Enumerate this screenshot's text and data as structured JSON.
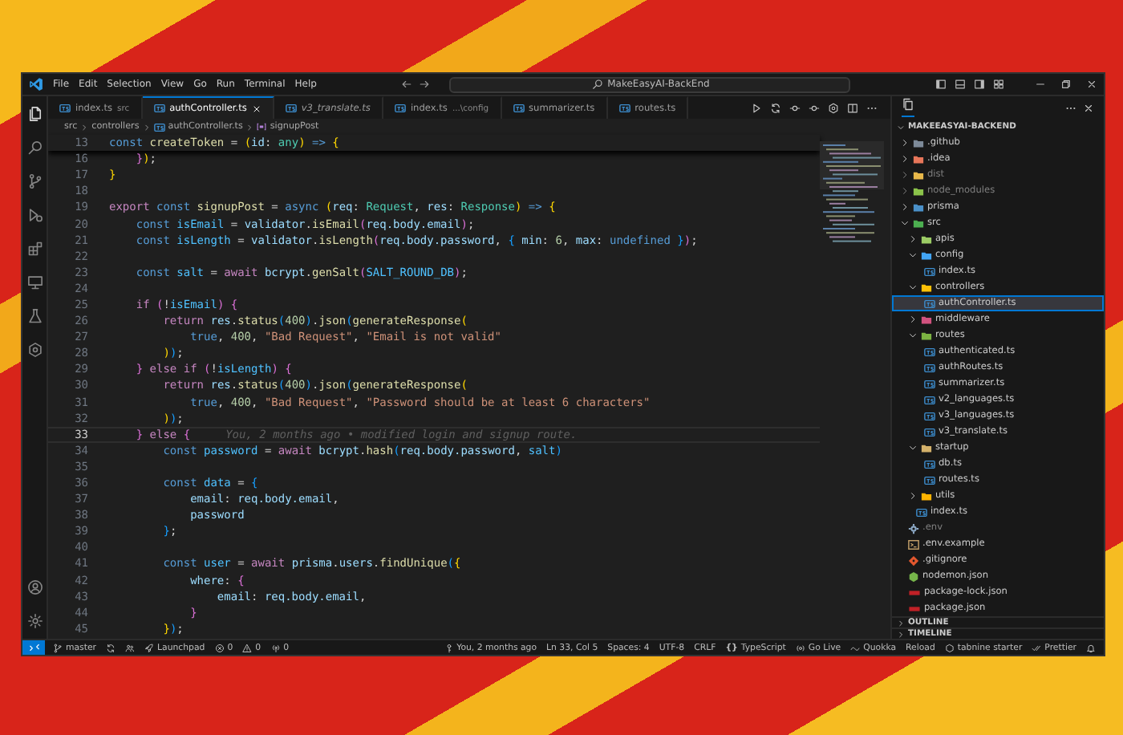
{
  "title_bar": {
    "menu": [
      "File",
      "Edit",
      "Selection",
      "View",
      "Go",
      "Run",
      "Terminal",
      "Help"
    ],
    "search": "MakeEasyAI-BackEnd"
  },
  "editor": {
    "tabs": [
      {
        "label": "index.ts",
        "description": "src",
        "selected": false,
        "preview": false
      },
      {
        "label": "authController.ts",
        "selected": true,
        "preview": false
      },
      {
        "label": "v3_translate.ts",
        "selected": false,
        "preview": true
      },
      {
        "label": "index.ts",
        "description": "...\\config",
        "selected": false,
        "preview": false
      },
      {
        "label": "summarizer.ts",
        "selected": false,
        "preview": false
      },
      {
        "label": "routes.ts",
        "selected": false,
        "preview": false
      }
    ],
    "breadcrumbs": [
      {
        "text": "src",
        "kind": "folder"
      },
      {
        "text": "controllers",
        "kind": "folder"
      },
      {
        "text": "authController.ts",
        "kind": "file"
      },
      {
        "text": "signupPost",
        "kind": "symbol"
      }
    ],
    "sticky_line": {
      "number": "13",
      "tokens": [
        {
          "text": "const",
          "kind": "kw"
        },
        {
          "text": " createToken",
          "kind": "fn"
        },
        {
          "text": " = "
        },
        {
          "text": "(",
          "kind": "b1"
        },
        {
          "text": "id",
          "kind": "var"
        },
        {
          "text": ": "
        },
        {
          "text": "any",
          "kind": "type"
        },
        {
          "text": ")",
          "kind": "b1"
        },
        {
          "text": " => ",
          "kind": "kw"
        },
        {
          "text": "{",
          "kind": "b1"
        }
      ]
    },
    "lines": [
      {
        "number": "16",
        "current": false,
        "tokens": [
          {
            "text": "    }",
            "kind": "b2"
          },
          {
            "text": ")",
            "kind": "b1"
          },
          {
            "text": ";"
          }
        ]
      },
      {
        "number": "17",
        "current": false,
        "tokens": [
          {
            "text": "}",
            "kind": "b1"
          }
        ]
      },
      {
        "number": "18",
        "current": false
      },
      {
        "number": "19",
        "current": false,
        "tokens": [
          {
            "text": "export",
            "kind": "ctl"
          },
          {
            "text": " const",
            "kind": "kw"
          },
          {
            "text": " signupPost",
            "kind": "fn"
          },
          {
            "text": " = "
          },
          {
            "text": "async",
            "kind": "kw"
          },
          {
            "text": " (",
            "kind": "b1"
          },
          {
            "text": "req",
            "kind": "var"
          },
          {
            "text": ": "
          },
          {
            "text": "Request",
            "kind": "type"
          },
          {
            "text": ", "
          },
          {
            "text": "res",
            "kind": "var"
          },
          {
            "text": ": "
          },
          {
            "text": "Response",
            "kind": "type"
          },
          {
            "text": ")",
            "kind": "b1"
          },
          {
            "text": " => ",
            "kind": "kw"
          },
          {
            "text": "{",
            "kind": "b1"
          }
        ]
      },
      {
        "number": "20",
        "current": false,
        "tokens": [
          {
            "text": "    const",
            "kind": "kw"
          },
          {
            "text": " isEmail",
            "kind": "cvar"
          },
          {
            "text": " = "
          },
          {
            "text": "validator",
            "kind": "var"
          },
          {
            "text": "."
          },
          {
            "text": "isEmail",
            "kind": "fn"
          },
          {
            "text": "(",
            "kind": "b2"
          },
          {
            "text": "req.body.email",
            "kind": "var"
          },
          {
            "text": ")",
            "kind": "b2"
          },
          {
            "text": ";"
          }
        ]
      },
      {
        "number": "21",
        "current": false,
        "tokens": [
          {
            "text": "    const",
            "kind": "kw"
          },
          {
            "text": " isLength",
            "kind": "cvar"
          },
          {
            "text": " = "
          },
          {
            "text": "validator",
            "kind": "var"
          },
          {
            "text": "."
          },
          {
            "text": "isLength",
            "kind": "fn"
          },
          {
            "text": "(",
            "kind": "b2"
          },
          {
            "text": "req.body.password",
            "kind": "var"
          },
          {
            "text": ", "
          },
          {
            "text": "{",
            "kind": "b3"
          },
          {
            "text": " min",
            "kind": "var"
          },
          {
            "text": ": "
          },
          {
            "text": "6",
            "kind": "num"
          },
          {
            "text": ", "
          },
          {
            "text": "max",
            "kind": "var"
          },
          {
            "text": ": "
          },
          {
            "text": "undefined",
            "kind": "kw"
          },
          {
            "text": " }",
            "kind": "b3"
          },
          {
            "text": ")",
            "kind": "b2"
          },
          {
            "text": ";"
          }
        ]
      },
      {
        "number": "22",
        "current": false
      },
      {
        "number": "23",
        "current": false,
        "tokens": [
          {
            "text": "    const",
            "kind": "kw"
          },
          {
            "text": " salt",
            "kind": "cvar"
          },
          {
            "text": " = "
          },
          {
            "text": "await",
            "kind": "ctl"
          },
          {
            "text": " bcrypt",
            "kind": "var"
          },
          {
            "text": "."
          },
          {
            "text": "genSalt",
            "kind": "fn"
          },
          {
            "text": "(",
            "kind": "b2"
          },
          {
            "text": "SALT_ROUND_DB",
            "kind": "cvar"
          },
          {
            "text": ")",
            "kind": "b2"
          },
          {
            "text": ";"
          }
        ]
      },
      {
        "number": "24",
        "current": false
      },
      {
        "number": "25",
        "current": false,
        "tokens": [
          {
            "text": "    if",
            "kind": "ctl"
          },
          {
            "text": " (",
            "kind": "b2"
          },
          {
            "text": "!"
          },
          {
            "text": "isEmail",
            "kind": "cvar"
          },
          {
            "text": ")",
            "kind": "b2"
          },
          {
            "text": " {",
            "kind": "b2"
          }
        ]
      },
      {
        "number": "26",
        "current": false,
        "tokens": [
          {
            "text": "        return",
            "kind": "ctl"
          },
          {
            "text": " res",
            "kind": "var"
          },
          {
            "text": "."
          },
          {
            "text": "status",
            "kind": "fn"
          },
          {
            "text": "(",
            "kind": "b3"
          },
          {
            "text": "400",
            "kind": "num"
          },
          {
            "text": ")",
            "kind": "b3"
          },
          {
            "text": "."
          },
          {
            "text": "json",
            "kind": "fn"
          },
          {
            "text": "(",
            "kind": "b3"
          },
          {
            "text": "generateResponse",
            "kind": "fn"
          },
          {
            "text": "(",
            "kind": "b1"
          }
        ]
      },
      {
        "number": "27",
        "current": false,
        "tokens": [
          {
            "text": "            true",
            "kind": "kw"
          },
          {
            "text": ", "
          },
          {
            "text": "400",
            "kind": "num"
          },
          {
            "text": ", "
          },
          {
            "text": "\"Bad Request\"",
            "kind": "str"
          },
          {
            "text": ", "
          },
          {
            "text": "\"Email is not valid\"",
            "kind": "str"
          }
        ]
      },
      {
        "number": "28",
        "current": false,
        "tokens": [
          {
            "text": "        )",
            "kind": "b1"
          },
          {
            "text": ")",
            "kind": "b3"
          },
          {
            "text": ";"
          }
        ]
      },
      {
        "number": "29",
        "current": false,
        "tokens": [
          {
            "text": "    }",
            "kind": "b2"
          },
          {
            "text": " else",
            "kind": "ctl"
          },
          {
            "text": " if",
            "kind": "ctl"
          },
          {
            "text": " (",
            "kind": "b2"
          },
          {
            "text": "!"
          },
          {
            "text": "isLength",
            "kind": "cvar"
          },
          {
            "text": ")",
            "kind": "b2"
          },
          {
            "text": " {",
            "kind": "b2"
          }
        ]
      },
      {
        "number": "30",
        "current": false,
        "tokens": [
          {
            "text": "        return",
            "kind": "ctl"
          },
          {
            "text": " res",
            "kind": "var"
          },
          {
            "text": "."
          },
          {
            "text": "status",
            "kind": "fn"
          },
          {
            "text": "(",
            "kind": "b3"
          },
          {
            "text": "400",
            "kind": "num"
          },
          {
            "text": ")",
            "kind": "b3"
          },
          {
            "text": "."
          },
          {
            "text": "json",
            "kind": "fn"
          },
          {
            "text": "(",
            "kind": "b3"
          },
          {
            "text": "generateResponse",
            "kind": "fn"
          },
          {
            "text": "(",
            "kind": "b1"
          }
        ]
      },
      {
        "number": "31",
        "current": false,
        "tokens": [
          {
            "text": "            true",
            "kind": "kw"
          },
          {
            "text": ", "
          },
          {
            "text": "400",
            "kind": "num"
          },
          {
            "text": ", "
          },
          {
            "text": "\"Bad Request\"",
            "kind": "str"
          },
          {
            "text": ", "
          },
          {
            "text": "\"Password should be at least 6 characters\"",
            "kind": "str"
          }
        ]
      },
      {
        "number": "32",
        "current": false,
        "tokens": [
          {
            "text": "        )",
            "kind": "b1"
          },
          {
            "text": ")",
            "kind": "b3"
          },
          {
            "text": ";"
          }
        ]
      },
      {
        "number": "33",
        "current": true,
        "blame": "You, 2 months ago • modified login and signup route.",
        "tokens": [
          {
            "text": "    }",
            "kind": "b2"
          },
          {
            "text": " else",
            "kind": "ctl"
          },
          {
            "text": " {",
            "kind": "b2"
          }
        ]
      },
      {
        "number": "34",
        "current": false,
        "tokens": [
          {
            "text": "        const",
            "kind": "kw"
          },
          {
            "text": " password",
            "kind": "cvar"
          },
          {
            "text": " = "
          },
          {
            "text": "await",
            "kind": "ctl"
          },
          {
            "text": " bcrypt",
            "kind": "var"
          },
          {
            "text": "."
          },
          {
            "text": "hash",
            "kind": "fn"
          },
          {
            "text": "(",
            "kind": "b3"
          },
          {
            "text": "req.body.password",
            "kind": "var"
          },
          {
            "text": ", "
          },
          {
            "text": "salt",
            "kind": "cvar"
          },
          {
            "text": ")",
            "kind": "b3"
          }
        ]
      },
      {
        "number": "35",
        "current": false
      },
      {
        "number": "36",
        "current": false,
        "tokens": [
          {
            "text": "        const",
            "kind": "kw"
          },
          {
            "text": " data",
            "kind": "cvar"
          },
          {
            "text": " = "
          },
          {
            "text": "{",
            "kind": "b3"
          }
        ]
      },
      {
        "number": "37",
        "current": false,
        "tokens": [
          {
            "text": "            email",
            "kind": "var"
          },
          {
            "text": ": "
          },
          {
            "text": "req.body.email",
            "kind": "var"
          },
          {
            "text": ","
          }
        ]
      },
      {
        "number": "38",
        "current": false,
        "tokens": [
          {
            "text": "            password",
            "kind": "var"
          }
        ]
      },
      {
        "number": "39",
        "current": false,
        "tokens": [
          {
            "text": "        }",
            "kind": "b3"
          },
          {
            "text": ";"
          }
        ]
      },
      {
        "number": "40",
        "current": false
      },
      {
        "number": "41",
        "current": false,
        "tokens": [
          {
            "text": "        const",
            "kind": "kw"
          },
          {
            "text": " user",
            "kind": "cvar"
          },
          {
            "text": " = "
          },
          {
            "text": "await",
            "kind": "ctl"
          },
          {
            "text": " prisma",
            "kind": "var"
          },
          {
            "text": "."
          },
          {
            "text": "users",
            "kind": "var"
          },
          {
            "text": "."
          },
          {
            "text": "findUnique",
            "kind": "fn"
          },
          {
            "text": "(",
            "kind": "b3"
          },
          {
            "text": "{",
            "kind": "b1"
          }
        ]
      },
      {
        "number": "42",
        "current": false,
        "tokens": [
          {
            "text": "            where",
            "kind": "var"
          },
          {
            "text": ": "
          },
          {
            "text": "{",
            "kind": "b2"
          }
        ]
      },
      {
        "number": "43",
        "current": false,
        "tokens": [
          {
            "text": "                email",
            "kind": "var"
          },
          {
            "text": ": "
          },
          {
            "text": "req.body.email",
            "kind": "var"
          },
          {
            "text": ","
          }
        ]
      },
      {
        "number": "44",
        "current": false,
        "tokens": [
          {
            "text": "            }",
            "kind": "b2"
          }
        ]
      },
      {
        "number": "45",
        "current": false,
        "tokens": [
          {
            "text": "        }",
            "kind": "b1"
          },
          {
            "text": ")",
            "kind": "b3"
          },
          {
            "text": ";"
          }
        ]
      }
    ]
  },
  "explorer": {
    "title": "MAKEEASYAI-BACKEND",
    "tree": [
      {
        "name": ".github",
        "kind": "folder",
        "color": "#7d8a99",
        "expanded": false,
        "selected": false,
        "ignored": false
      },
      {
        "name": ".idea",
        "kind": "folder",
        "color": "#e8765a",
        "expanded": false,
        "selected": false,
        "ignored": false
      },
      {
        "name": "dist",
        "kind": "folder",
        "color": "#e8b84a",
        "expanded": false,
        "selected": false,
        "ignored": true
      },
      {
        "name": "node_modules",
        "kind": "folder",
        "color": "#8bc34a",
        "expanded": false,
        "selected": false,
        "ignored": true
      },
      {
        "name": "prisma",
        "kind": "folder",
        "color": "#4a90c8",
        "expanded": false,
        "selected": false,
        "ignored": false
      },
      {
        "name": "src",
        "kind": "folder",
        "color": "#4caf50",
        "expanded": true,
        "selected": false,
        "ignored": false,
        "children": [
          {
            "name": "apis",
            "kind": "folder",
            "color": "#9ccc65",
            "expanded": false,
            "selected": false,
            "ignored": false
          },
          {
            "name": "config",
            "kind": "folder",
            "color": "#42a5f5",
            "expanded": true,
            "selected": false,
            "ignored": false,
            "children": [
              {
                "name": "index.ts",
                "kind": "ts",
                "selected": false,
                "ignored": false
              }
            ]
          },
          {
            "name": "controllers",
            "kind": "folder",
            "color": "#ffc107",
            "expanded": true,
            "selected": false,
            "ignored": false,
            "children": [
              {
                "name": "authController.ts",
                "kind": "ts",
                "selected": true,
                "ignored": false
              }
            ]
          },
          {
            "name": "middleware",
            "kind": "folder",
            "color": "#d2527f",
            "expanded": false,
            "selected": false,
            "ignored": false
          },
          {
            "name": "routes",
            "kind": "folder",
            "color": "#7cb342",
            "expanded": true,
            "selected": false,
            "ignored": false,
            "children": [
              {
                "name": "authenticated.ts",
                "kind": "ts",
                "selected": false,
                "ignored": false
              },
              {
                "name": "authRoutes.ts",
                "kind": "ts",
                "selected": false,
                "ignored": false
              },
              {
                "name": "summarizer.ts",
                "kind": "ts",
                "selected": false,
                "ignored": false
              },
              {
                "name": "v2_languages.ts",
                "kind": "ts",
                "selected": false,
                "ignored": false
              },
              {
                "name": "v3_languages.ts",
                "kind": "ts",
                "selected": false,
                "ignored": false
              },
              {
                "name": "v3_translate.ts",
                "kind": "ts",
                "selected": false,
                "ignored": false
              }
            ]
          },
          {
            "name": "startup",
            "kind": "folder",
            "color": "#d4b16a",
            "expanded": true,
            "selected": false,
            "ignored": false,
            "children": [
              {
                "name": "db.ts",
                "kind": "ts",
                "selected": false,
                "ignored": false
              },
              {
                "name": "routes.ts",
                "kind": "ts",
                "selected": false,
                "ignored": false
              }
            ]
          },
          {
            "name": "utils",
            "kind": "folder",
            "color": "#ffb300",
            "expanded": false,
            "selected": false,
            "ignored": false
          },
          {
            "name": "index.ts",
            "kind": "ts",
            "selected": false,
            "ignored": false
          }
        ]
      },
      {
        "name": ".env",
        "kind": "env",
        "selected": false,
        "ignored": true
      },
      {
        "name": ".env.example",
        "kind": "env-example",
        "selected": false,
        "ignored": false
      },
      {
        "name": ".gitignore",
        "kind": "git",
        "selected": false,
        "ignored": false
      },
      {
        "name": "nodemon.json",
        "kind": "nodemon",
        "selected": false,
        "ignored": false
      },
      {
        "name": "package-lock.json",
        "kind": "npm",
        "selected": false,
        "ignored": false
      },
      {
        "name": "package.json",
        "kind": "npm",
        "selected": false,
        "ignored": false
      }
    ],
    "sections": [
      {
        "label": "OUTLINE",
        "expanded": false
      },
      {
        "label": "TIMELINE",
        "expanded": false
      }
    ]
  },
  "status_bar": {
    "left": [
      {
        "kind": "branch",
        "text": "master"
      },
      {
        "kind": "sync"
      },
      {
        "kind": "accounts"
      },
      {
        "kind": "launchpad",
        "text": "Launchpad"
      },
      {
        "kind": "errors",
        "text": "0"
      },
      {
        "kind": "warnings",
        "text": "0"
      },
      {
        "kind": "ports",
        "text": "0"
      }
    ],
    "right": [
      {
        "kind": "blame",
        "text": "You, 2 months ago"
      },
      {
        "kind": "text",
        "text": "Ln 33, Col 5"
      },
      {
        "kind": "text",
        "text": "Spaces: 4"
      },
      {
        "kind": "text",
        "text": "UTF-8"
      },
      {
        "kind": "text",
        "text": "CRLF"
      },
      {
        "kind": "language",
        "glyph": "{}",
        "text": "TypeScript"
      },
      {
        "kind": "golive",
        "text": "Go Live"
      },
      {
        "kind": "quokka",
        "text": "Quokka"
      },
      {
        "kind": "text",
        "text": "Reload"
      },
      {
        "kind": "tabnine",
        "text": "tabnine starter"
      },
      {
        "kind": "prettier",
        "text": "Prettier"
      },
      {
        "kind": "bell"
      }
    ]
  }
}
